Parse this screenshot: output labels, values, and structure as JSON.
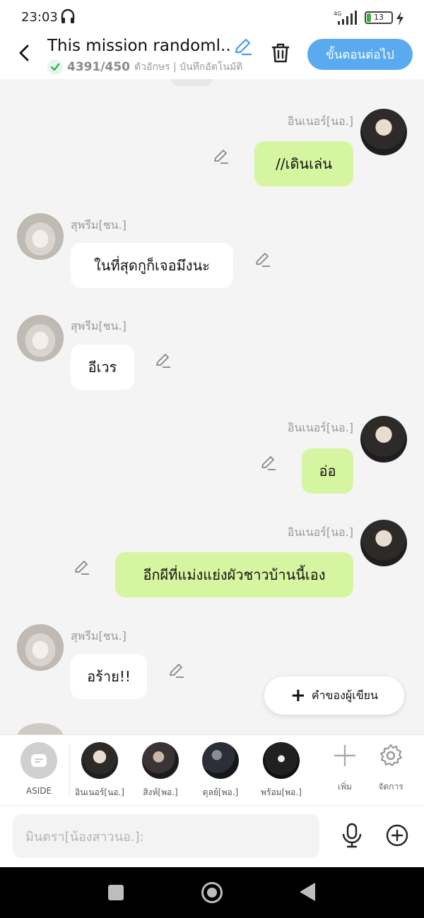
{
  "status": {
    "time": "23:03",
    "network": "4G",
    "battery": "13"
  },
  "header": {
    "title": "This mission randoml...",
    "char_count": "4391/450",
    "meta": "ตัวอักษร | บันทึกอัตโนมัติ",
    "next_label": "ขั้นตอนต่อไป"
  },
  "messages": [
    {
      "side": "right",
      "name": "อินเนอร์[นอ.]",
      "text": "//เดินเล่น"
    },
    {
      "side": "left",
      "name": "สุพรีม[ชน.]",
      "text": "ในที่สุดกูก็เจอมึงนะ"
    },
    {
      "side": "left",
      "name": "สุพรีม[ชน.]",
      "text": "อีเวร"
    },
    {
      "side": "right",
      "name": "อินเนอร์[นอ.]",
      "text": "อ่อ"
    },
    {
      "side": "right",
      "name": "อินเนอร์[นอ.]",
      "text": "อีกผีที่แม่งแย่งผัวชาวบ้านนี้เอง"
    },
    {
      "side": "left",
      "name": "สุพรีม[ชน.]",
      "text": "อร้าย!!"
    }
  ],
  "fab": {
    "label": "คำของผู้เขียน"
  },
  "characters": [
    {
      "label": "ASIDE",
      "icon": "aside-icon"
    },
    {
      "label": "อินเนอร์[นอ.]"
    },
    {
      "label": "สิงห์[พอ.]"
    },
    {
      "label": "ดุลย์[พอ.]"
    },
    {
      "label": "พร้อม[พอ.]"
    }
  ],
  "tools": {
    "add_label": "เพิ่ม",
    "manage_label": "จัดการ"
  },
  "input": {
    "placeholder": "มินตรา[น้องสาวนอ.]:"
  },
  "colors": {
    "accent": "#5aaaf0",
    "bubble_green": "#d6f5a0",
    "chat_bg": "#f4f4f4"
  }
}
